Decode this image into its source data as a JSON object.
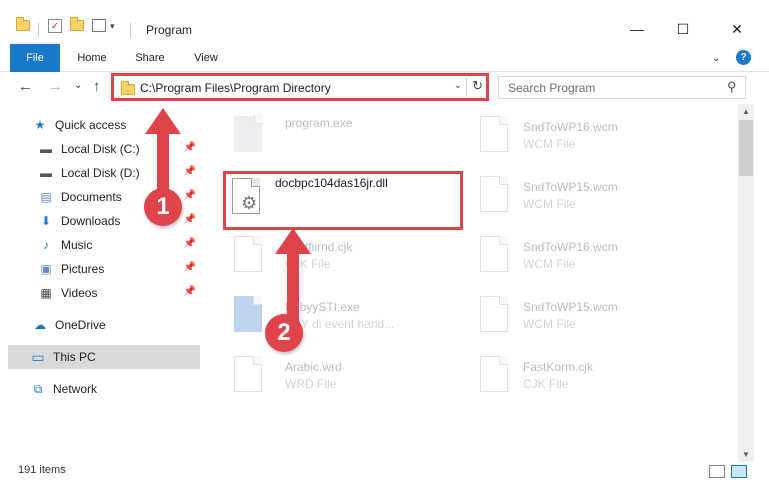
{
  "titlebar": {
    "title": "Program",
    "dropdown_glyph": "▾",
    "minimize": "—",
    "maximize": "☐",
    "close": "✕"
  },
  "ribbon": {
    "tabs": [
      "File",
      "Home",
      "Share",
      "View"
    ],
    "expand_glyph": "⌄",
    "help": "?"
  },
  "address": {
    "path": "C:\\Program Files\\Program Directory",
    "dropdown_glyph": "⌄",
    "refresh_glyph": "↻",
    "back_glyph": "←",
    "forward_glyph": "→",
    "recent_glyph": "⌄",
    "up_glyph": "↑"
  },
  "search": {
    "placeholder": "Search Program",
    "icon_glyph": "⚲"
  },
  "sidebar": {
    "pin_glyph": "📌",
    "items": [
      {
        "label": "Quick access",
        "icon": "star-icon",
        "glyph": "★",
        "color": "#1979ca"
      },
      {
        "label": "Local Disk (C:)",
        "icon": "disk-icon",
        "glyph": "▬",
        "color": "#555555"
      },
      {
        "label": "Local Disk (D:)",
        "icon": "disk-icon",
        "glyph": "▬",
        "color": "#555555"
      },
      {
        "label": "Documents",
        "icon": "documents-icon",
        "glyph": "▤",
        "color": "#5a8ac6"
      },
      {
        "label": "Downloads",
        "icon": "download-icon",
        "glyph": "⬇",
        "color": "#1979ca"
      },
      {
        "label": "Music",
        "icon": "music-icon",
        "glyph": "♪",
        "color": "#1979ca"
      },
      {
        "label": "Pictures",
        "icon": "pictures-icon",
        "glyph": "▣",
        "color": "#5a8ac6"
      },
      {
        "label": "Videos",
        "icon": "videos-icon",
        "glyph": "▦",
        "color": "#444444"
      },
      {
        "label": "OneDrive",
        "icon": "cloud-icon",
        "glyph": "☁",
        "color": "#1979ca"
      },
      {
        "label": "This PC",
        "icon": "computer-icon",
        "glyph": "▭",
        "color": "#1979ca"
      },
      {
        "label": "Network",
        "icon": "network-icon",
        "glyph": "⧉",
        "color": "#1979ca"
      }
    ]
  },
  "files": {
    "left": [
      {
        "name": "program.exe",
        "type": ""
      },
      {
        "name": "docbpc104das16jr.dll",
        "type": ""
      },
      {
        "name": "Fastfiirnd.cjk",
        "type": "CJK File"
      },
      {
        "name": "BbbyySTI.exe",
        "type": "BBY di event hand..."
      },
      {
        "name": "Arabic.wrd",
        "type": "WRD File"
      }
    ],
    "right": [
      {
        "name": "SndToWP16.wcm",
        "type": "WCM File"
      },
      {
        "name": "SndToWP15.wcm",
        "type": "WCM File"
      },
      {
        "name": "SndToWP16.wcm",
        "type": "WCM File"
      },
      {
        "name": "SndToWP15.wcm",
        "type": "WCM File"
      },
      {
        "name": "FastKorm.cjk",
        "type": "CJK File"
      }
    ]
  },
  "annotations": {
    "step1": "1",
    "step2": "2",
    "accent": "#e0444b"
  },
  "status": {
    "items_count": "191 items"
  },
  "scrollbar": {
    "up_glyph": "▲",
    "down_glyph": "▼"
  }
}
